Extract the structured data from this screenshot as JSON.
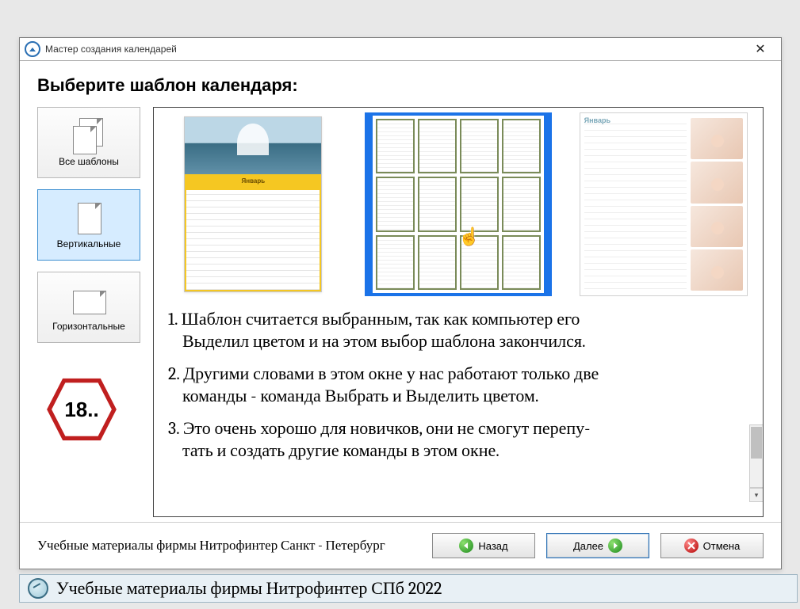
{
  "window": {
    "title": "Мастер создания календарей"
  },
  "heading": "Выберите шаблон календаря:",
  "sidebar": {
    "all": "Все шаблоны",
    "vertical": "Вертикальные",
    "horizontal": "Горизонтальные"
  },
  "badge": "18..",
  "templates": {
    "t1_month": "Январь",
    "t3_month": "Январь"
  },
  "explain": {
    "p1a": "1. Шаблон считается выбранным, так как компьютер его",
    "p1b": "Выделил цветом и на этом выбор шаблона закончился.",
    "p2a": "2. Другими словами в этом окне у нас работают только две",
    "p2b": "команды - команда Выбрать и Выделить цветом.",
    "p3a": "3. Это очень хорошо для новичков, они не смогут перепу-",
    "p3b": "тать и создать другие команды в этом окне."
  },
  "footer": {
    "text": "Учебные материалы фирмы Нитрофинтер Санкт - Петербург",
    "back": "Назад",
    "next": "Далее",
    "cancel": "Отмена"
  },
  "status": "Учебные материалы фирмы Нитрофинтер СПб 2022"
}
